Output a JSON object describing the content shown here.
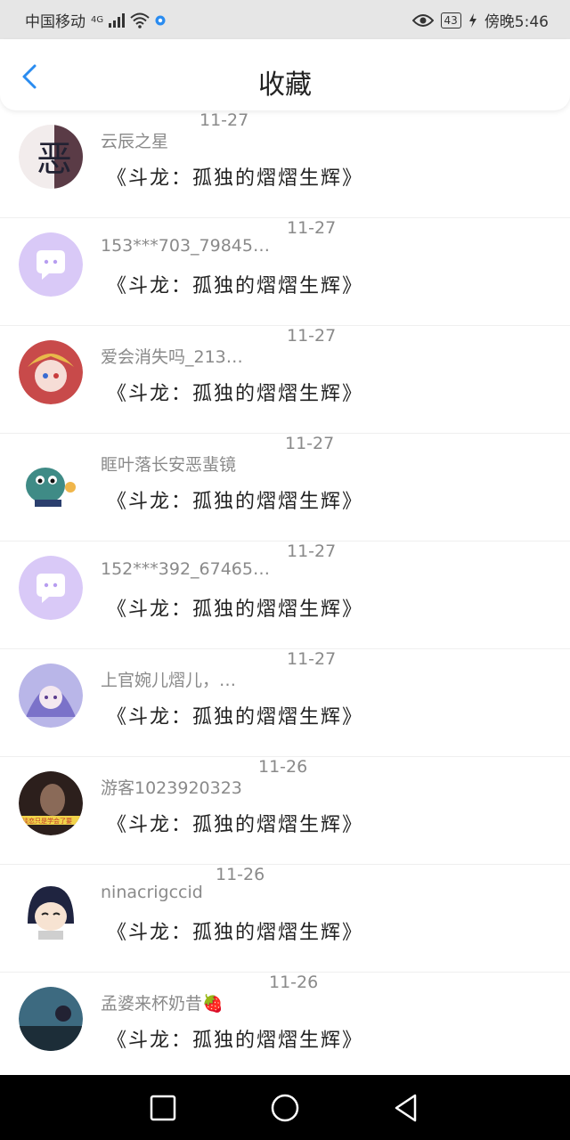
{
  "status_bar": {
    "carrier": "中国移动",
    "network": "4G",
    "battery": "43",
    "time": "傍晚5:46"
  },
  "header": {
    "title": "收藏",
    "back_icon": "chevron-left-icon"
  },
  "items": [
    {
      "username": "云辰之星",
      "date": "11-27",
      "content": "《斗龙：孤独的熠熠生辉》",
      "avatar": "ink-character"
    },
    {
      "username": "153***703_798454…",
      "date": "11-27",
      "content": "《斗龙：孤独的熠熠生辉》",
      "avatar": "default-chat"
    },
    {
      "username": "爱会消失吗_213…",
      "date": "11-27",
      "content": "《斗龙：孤独的熠熠生辉》",
      "avatar": "anime-girl"
    },
    {
      "username": "眶叶落长安恶蜚镜",
      "date": "11-27",
      "content": "《斗龙：孤独的熠熠生辉》",
      "avatar": "green-dino"
    },
    {
      "username": "152***392_674659…",
      "date": "11-27",
      "content": "《斗龙：孤独的熠熠生辉》",
      "avatar": "default-chat"
    },
    {
      "username": "上官婉儿熠儿，…",
      "date": "11-27",
      "content": "《斗龙：孤独的熠熠生辉》",
      "avatar": "purple-anime"
    },
    {
      "username": "游客1023920323",
      "date": "11-26",
      "content": "《斗龙：孤独的熠熠生辉》",
      "avatar": "photo-girl",
      "avatar_caption": "谈恋只是学会了要"
    },
    {
      "username": "ninacrigccid",
      "date": "11-26",
      "content": "《斗龙：孤独的熠熠生辉》",
      "avatar": "chibi-girl"
    },
    {
      "username": "孟婆来杯奶昔🍓",
      "date": "11-26",
      "content": "《斗龙：孤独的熠熠生辉》",
      "avatar": "blue-photo"
    }
  ],
  "nav": {
    "recent_icon": "square-icon",
    "home_icon": "circle-icon",
    "back_icon": "triangle-back-icon"
  },
  "colors": {
    "accent": "#2a8cf0",
    "default_avatar": "#d9c9f7",
    "meta_text": "#8a8a8a"
  }
}
